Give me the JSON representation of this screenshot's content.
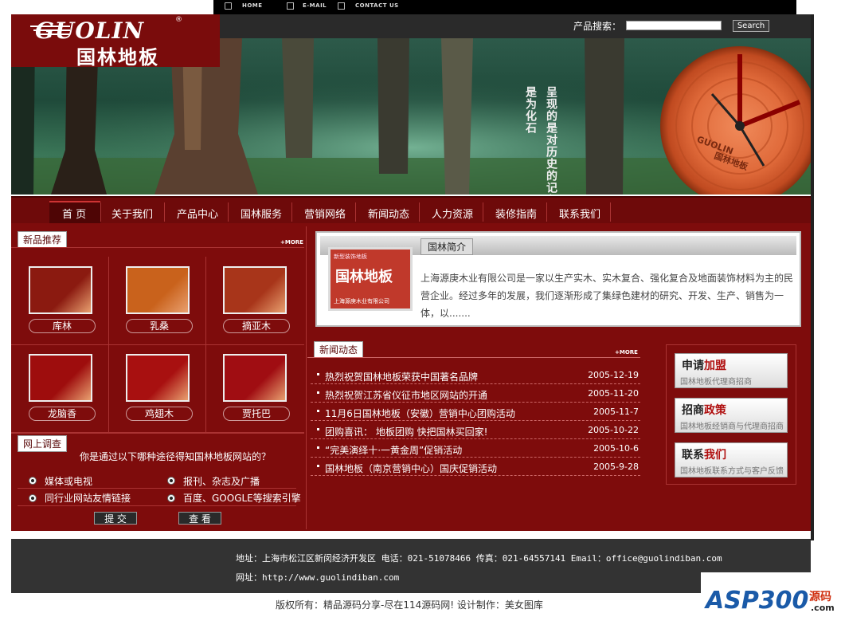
{
  "topnav": {
    "home": "HOME",
    "email": "E-MAIL",
    "contact": "CONTACT US"
  },
  "logo": {
    "en": "GUOLIN",
    "zh": "国林地板",
    "reg": "®"
  },
  "search": {
    "label": "产品搜索：",
    "button": "Search"
  },
  "banner": {
    "slogan_col1": "呈现的是对历史的记印",
    "slogan_col2": "是为化石",
    "clock_brand": "GUOLIN",
    "clock_text": "国林地板"
  },
  "nav": [
    "首 页",
    "关于我们",
    "产品中心",
    "国林服务",
    "营销网络",
    "新闻动态",
    "人力资源",
    "装修指南",
    "联系我们"
  ],
  "products": {
    "title": "新品推荐",
    "more": "+MORE",
    "items": [
      {
        "label": "库林",
        "color": "#8b1a10"
      },
      {
        "label": "乳桑",
        "color": "#c9621c"
      },
      {
        "label": "摘亚木",
        "color": "#a8351a"
      },
      {
        "label": "龙脑香",
        "color": "#9e0d0d"
      },
      {
        "label": "鸡翅木",
        "color": "#a81010"
      },
      {
        "label": "贾托巴",
        "color": "#a00d12"
      }
    ]
  },
  "poll": {
    "title": "网上调查",
    "question": "你是通过以下哪种途径得知国林地板网站的？",
    "options": [
      "媒体或电视",
      "报刊、杂志及广播",
      "同行业网站友情链接",
      "百度、GOOGLE等搜索引擎"
    ],
    "submit": "提 交",
    "view": "查 看"
  },
  "intro": {
    "title": "国林简介",
    "img_top": "新型装饰地板",
    "img_title": "国林地板",
    "img_bottom": "上海源庚木业有限公司",
    "text": "上海源庚木业有限公司是一家以生产实木、实木复合、强化复合及地面装饰材料为主的民营企业。经过多年的发展，我们逐渐形成了集绿色建材的研究、开发、生产、销售为一体，以......."
  },
  "news": {
    "title": "新闻动态",
    "more": "+MORE",
    "items": [
      {
        "title": "热烈祝贺国林地板荣获中国著名品牌",
        "date": "2005-12-19"
      },
      {
        "title": "热烈祝贺江苏省仪征市地区网站的开通",
        "date": "2005-11-20"
      },
      {
        "title": "11月6日国林地板（安徽）营销中心团购活动",
        "date": "2005-11-7"
      },
      {
        "title": "团购喜讯： 地板团购 快把国林买回家!",
        "date": "2005-10-22"
      },
      {
        "title": "“完美演绎十·一黄金周”促销活动",
        "date": "2005-10-6"
      },
      {
        "title": "国林地板（南京营销中心）国庆促销活动",
        "date": "2005-9-28"
      }
    ]
  },
  "promo": [
    {
      "h1": "申请",
      "h2": "加盟",
      "sub": "国林地板代理商招商"
    },
    {
      "h1": "招商",
      "h2": "政策",
      "sub": "国林地板经销商与代理商招商"
    },
    {
      "h1": "联系",
      "h2": "我们",
      "sub": "国林地板联系方式与客户反馈"
    }
  ],
  "footer": {
    "address": "地址：上海市松江区新闵经济开发区 电话：021-51078466 传真：021-64557141 Email：office@guolindiban.com",
    "site": "网址：http://www.guolindiban.com",
    "copyright": "版权所有：精品源码分享-尽在114源码网! 设计制作：美女图库"
  },
  "watermark": {
    "text": "ASP300",
    "zh": "源码",
    "domain": ".com"
  }
}
